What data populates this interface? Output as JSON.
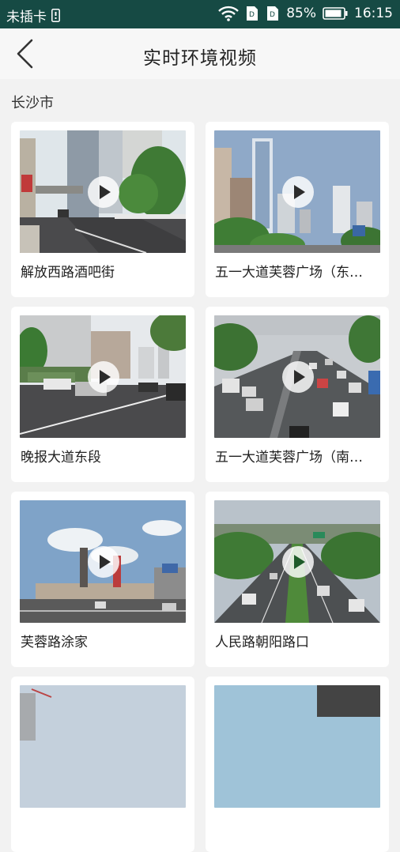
{
  "status_bar": {
    "carrier": "未插卡",
    "battery": "85%",
    "time": "16:15",
    "icons": [
      "sim-icon",
      "wifi-icon",
      "data-card-icon",
      "data-card-icon",
      "battery-icon"
    ]
  },
  "header": {
    "title": "实时环境视频",
    "back_icon": "chevron-left-icon"
  },
  "section": {
    "city": "长沙市"
  },
  "videos": [
    {
      "caption": "解放西路酒吧街"
    },
    {
      "caption": "五一大道芙蓉广场（东…"
    },
    {
      "caption": "晚报大道东段"
    },
    {
      "caption": "五一大道芙蓉广场（南…"
    },
    {
      "caption": "芙蓉路涂家"
    },
    {
      "caption": "人民路朝阳路口"
    },
    {
      "caption": ""
    },
    {
      "caption": ""
    }
  ],
  "colors": {
    "status_bar": "#164a44",
    "background": "#f2f2f2",
    "card": "#ffffff"
  }
}
